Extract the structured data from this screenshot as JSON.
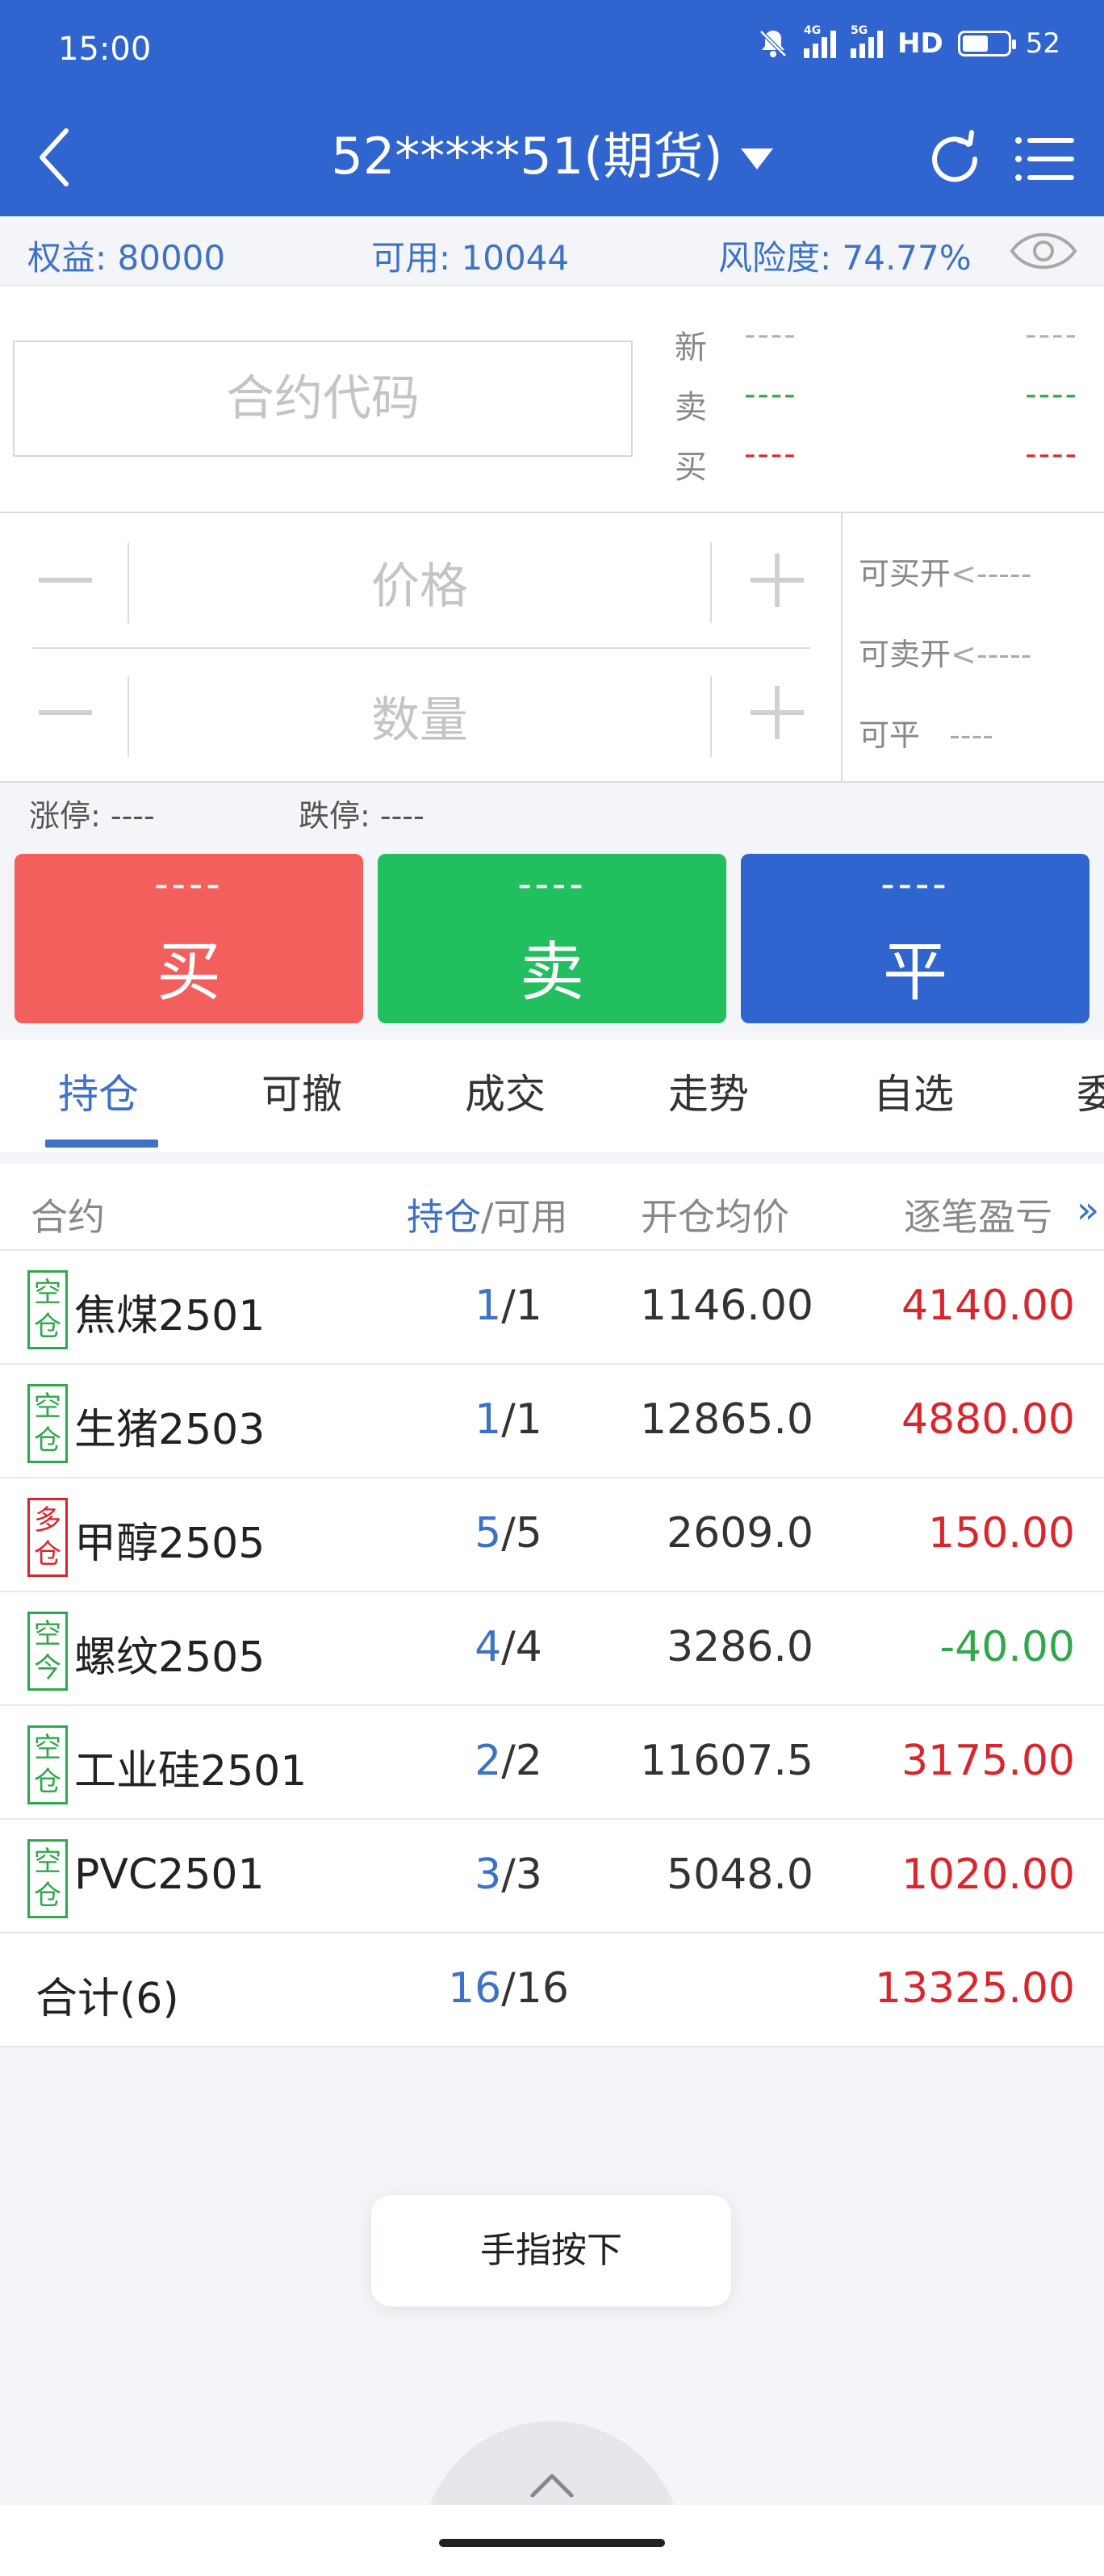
{
  "status_bar": {
    "time": "15:00",
    "net1": "4G",
    "net2": "5G",
    "hd": "HD",
    "battery": "52"
  },
  "header": {
    "account": "52*****51(期货)",
    "back_icon": "chevron-left-icon",
    "refresh_icon": "refresh-icon",
    "menu_icon": "list-menu-icon"
  },
  "summary": {
    "equity": "权益: 80000",
    "available": "可用: 10044",
    "risk": "风险度: 74.77%"
  },
  "order": {
    "code_placeholder": "合约代码",
    "quote": [
      {
        "label": "新",
        "v1": "----",
        "v2": "----",
        "color": "#999999"
      },
      {
        "label": "卖",
        "v1": "----",
        "v2": "----",
        "color": "#2fa84a"
      },
      {
        "label": "买",
        "v1": "----",
        "v2": "----",
        "color": "#d8262c"
      }
    ],
    "price_placeholder": "价格",
    "qty_placeholder": "数量",
    "can_buy_open": "可买开",
    "can_buy_open_val": "<-----",
    "can_sell_open": "可卖开",
    "can_sell_open_val": "<-----",
    "can_close": "可平",
    "can_close_val": "----",
    "limit_up": "涨停: ----",
    "limit_down": "跌停: ----"
  },
  "buttons": {
    "buy": {
      "top": "----",
      "label": "买",
      "color": "#f25f5c"
    },
    "sell": {
      "top": "----",
      "label": "卖",
      "color": "#21bf5e"
    },
    "close": {
      "top": "----",
      "label": "平",
      "color": "#3064cf"
    }
  },
  "tabs": [
    "持仓",
    "可撤",
    "成交",
    "走势",
    "自选",
    "委"
  ],
  "table": {
    "headers": {
      "contract": "合约",
      "pos_a": "持仓",
      "pos_b": "/可用",
      "avg_price": "开仓均价",
      "pnl": "逐笔盈亏",
      "more": "»"
    },
    "rows": [
      {
        "badge": [
          "空",
          "仓"
        ],
        "side": "short",
        "name": "焦煤2501",
        "pos": "1",
        "avail": "/1",
        "price": "1146.00",
        "pnl": "4140.00",
        "pnl_sign": "pos"
      },
      {
        "badge": [
          "空",
          "仓"
        ],
        "side": "short",
        "name": "生猪2503",
        "pos": "1",
        "avail": "/1",
        "price": "12865.0",
        "pnl": "4880.00",
        "pnl_sign": "pos"
      },
      {
        "badge": [
          "多",
          "仓"
        ],
        "side": "long",
        "name": "甲醇2505",
        "pos": "5",
        "avail": "/5",
        "price": "2609.0",
        "pnl": "150.00",
        "pnl_sign": "pos"
      },
      {
        "badge": [
          "空",
          "今"
        ],
        "side": "short",
        "name": "螺纹2505",
        "pos": "4",
        "avail": "/4",
        "price": "3286.0",
        "pnl": "-40.00",
        "pnl_sign": "neg"
      },
      {
        "badge": [
          "空",
          "仓"
        ],
        "side": "short",
        "name": "工业硅2501",
        "pos": "2",
        "avail": "/2",
        "price": "11607.5",
        "pnl": "3175.00",
        "pnl_sign": "pos"
      },
      {
        "badge": [
          "空",
          "仓"
        ],
        "side": "short",
        "name": "PVC2501",
        "pos": "3",
        "avail": "/3",
        "price": "5048.0",
        "pnl": "1020.00",
        "pnl_sign": "pos"
      }
    ],
    "total": {
      "label": "合计(6)",
      "pos": "16",
      "avail": "/16",
      "pnl": "13325.00"
    }
  },
  "toast": "手指按下"
}
